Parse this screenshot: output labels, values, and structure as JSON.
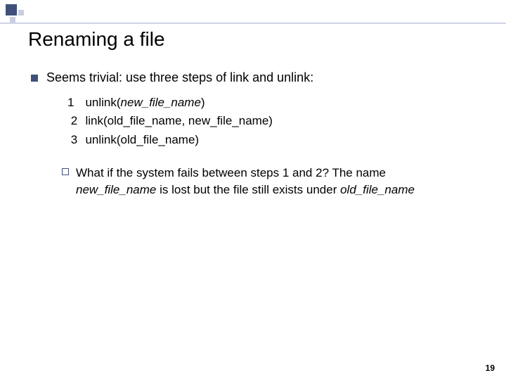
{
  "title": "Renaming a file",
  "bullet": {
    "text": "Seems trivial: use three steps of link and unlink:"
  },
  "steps": {
    "s1": {
      "num": "1",
      "prefix": "unlink(",
      "arg": "new_file_name",
      "suffix": ")"
    },
    "s2": {
      "num": "2",
      "text": "link(old_file_name, new_file_name)"
    },
    "s3": {
      "num": "3",
      "text": "unlink(old_file_name)"
    }
  },
  "sub": {
    "lead": "What if  the system fails between steps 1 and 2? The name ",
    "em1": "new_file_name",
    "mid": " is lost but the file still exists under ",
    "em2": "old_file_name"
  },
  "page": "19"
}
